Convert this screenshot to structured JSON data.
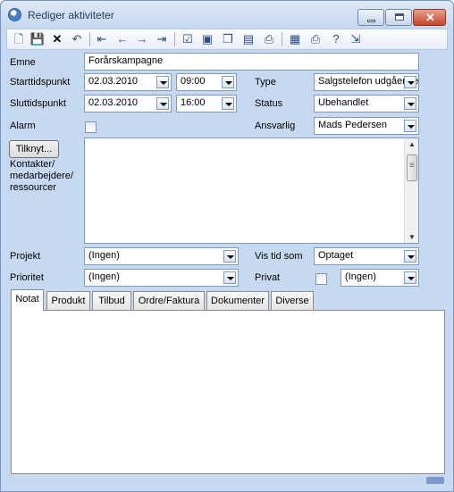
{
  "window": {
    "title": "Rediger aktiviteter"
  },
  "toolbar": {
    "icons": [
      "new-icon",
      "save-icon",
      "delete-icon",
      "undo-icon",
      "first-record-icon",
      "prev-record-icon",
      "next-record-icon",
      "last-record-icon",
      "check-icon",
      "preview-icon",
      "copy-icon",
      "folder-icon",
      "print-icon",
      "properties-icon",
      "printer-icon",
      "help-icon",
      "exit-icon"
    ]
  },
  "form": {
    "emne": {
      "label": "Emne",
      "value": "Forårskampagne"
    },
    "start": {
      "label": "Starttidspunkt",
      "date": "02.03.2010",
      "time": "09:00"
    },
    "slut": {
      "label": "Sluttidspunkt",
      "date": "02.03.2010",
      "time": "16:00"
    },
    "alarm": {
      "label": "Alarm"
    },
    "type": {
      "label": "Type",
      "value": "Salgstelefon udgående"
    },
    "status": {
      "label": "Status",
      "value": "Ubehandlet"
    },
    "ansvarlig": {
      "label": "Ansvarlig",
      "value": "Mads  Pedersen"
    },
    "tilknyt": {
      "button": "Tilknyt...",
      "label": "Kontakter/ medarbejdere/ ressourcer"
    },
    "projekt": {
      "label": "Projekt",
      "value": "(Ingen)"
    },
    "prioritet": {
      "label": "Prioritet",
      "value": "(Ingen)"
    },
    "vis_tid_som": {
      "label": "Vis tid som",
      "value": "Optaget"
    },
    "privat": {
      "label": "Privat",
      "value": "(Ingen)"
    }
  },
  "tabs": [
    "Notat",
    "Produkt",
    "Tilbud",
    "Ordre/Faktura",
    "Dokumenter",
    "Diverse"
  ]
}
